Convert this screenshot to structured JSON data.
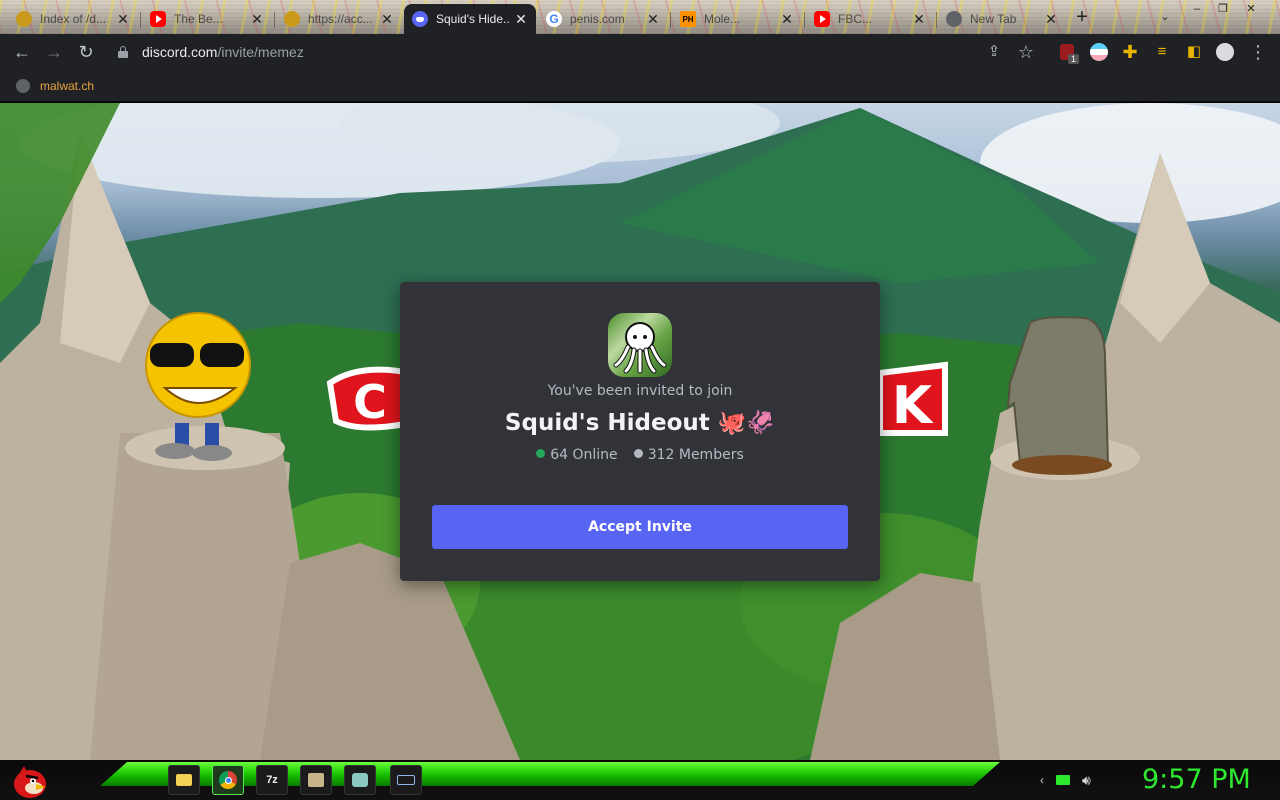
{
  "browser": {
    "tabs": [
      {
        "title": "Index of /d...",
        "icon": "generic-favicon-icon",
        "active": false
      },
      {
        "title": "The Be...",
        "icon": "youtube-icon",
        "active": false
      },
      {
        "title": "https://acc...",
        "icon": "generic-favicon-icon",
        "active": false
      },
      {
        "title": "Squid's Hide...",
        "icon": "discord-icon",
        "active": true
      },
      {
        "title": "penis.com",
        "icon": "google-icon",
        "active": false
      },
      {
        "title": "Mole...",
        "icon": "pornhub-icon",
        "active": false
      },
      {
        "title": "FBC...",
        "icon": "youtube-icon",
        "active": false
      },
      {
        "title": "New Tab",
        "icon": "chrome-globe-icon",
        "active": false
      }
    ],
    "new_tab_symbol": "+",
    "window_controls": [
      "–",
      "❐",
      "✕"
    ],
    "address": {
      "host": "discord.com",
      "path": "/invite/memez"
    },
    "extension_badge": "1",
    "bookmarks": [
      {
        "label": "malwat.ch",
        "icon": "globe-icon"
      }
    ]
  },
  "invite": {
    "invited_text": "You've been invited to join",
    "server_name": "Squid's Hideout 🐙🦑",
    "online_count": "64 Online",
    "member_count": "312 Members",
    "accept_label": "Accept Invite",
    "colors": {
      "card": "#313338",
      "button": "#5865f2",
      "online": "#23a55a",
      "members": "#b5bac1"
    }
  },
  "background": {
    "partial_text_left": "C",
    "partial_text_right": "K"
  },
  "taskbar": {
    "apps": [
      "folder-icon",
      "chrome-icon",
      "7zip-icon",
      "app-icon",
      "app2-icon",
      "keyboard-icon"
    ],
    "app_label_7zip": "7z",
    "clock": "9:57 PM"
  }
}
